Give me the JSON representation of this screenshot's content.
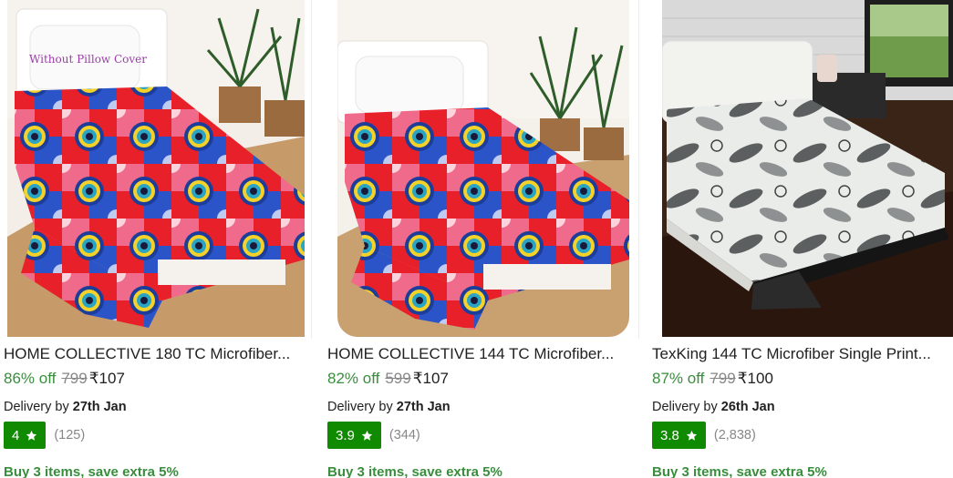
{
  "products": [
    {
      "title": "HOME COLLECTIVE 180 TC Microfiber...",
      "image_overlay_text": "Without Pillow Cover",
      "discount": "86% off",
      "mrp": "799",
      "price": "₹107",
      "delivery_prefix": "Delivery by",
      "delivery_date": "27th Jan",
      "rating": "4",
      "rating_count": "(125)",
      "offer": "Buy 3 items, save extra 5%"
    },
    {
      "title": "HOME COLLECTIVE 144 TC Microfiber...",
      "discount": "82% off",
      "mrp": "599",
      "price": "₹107",
      "delivery_prefix": "Delivery by",
      "delivery_date": "27th Jan",
      "rating": "3.9",
      "rating_count": "(344)",
      "offer": "Buy 3 items, save extra 5%"
    },
    {
      "title": "TexKing 144 TC Microfiber Single Print...",
      "discount": "87% off",
      "mrp": "799",
      "price": "₹100",
      "delivery_prefix": "Delivery by",
      "delivery_date": "26th Jan",
      "rating": "3.8",
      "rating_count": "(2,838)",
      "offer": "Buy 3 items, save extra 5%"
    }
  ],
  "colors": {
    "discount_green": "#388e3c",
    "rating_badge_green": "#108a00",
    "muted_gray": "#878787",
    "text": "#212121"
  },
  "icons": [
    "star-icon"
  ]
}
